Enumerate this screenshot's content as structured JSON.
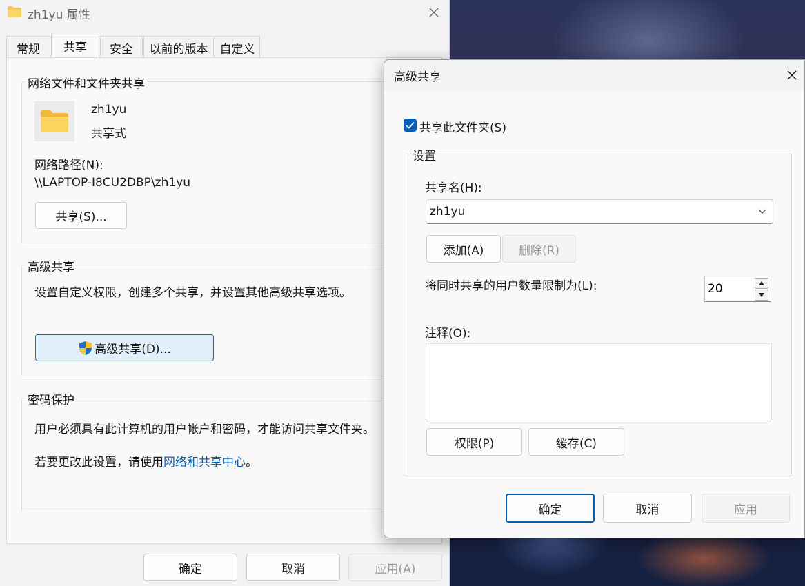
{
  "properties_window": {
    "title": "zh1yu 属性",
    "tabs": [
      {
        "label": "常规"
      },
      {
        "label": "共享"
      },
      {
        "label": "安全"
      },
      {
        "label": "以前的版本"
      },
      {
        "label": "自定义"
      }
    ],
    "network_sharing": {
      "group_title": "网络文件和文件夹共享",
      "folder_name": "zh1yu",
      "folder_status": "共享式",
      "path_label": "网络路径(N):",
      "path_value": "\\\\LAPTOP-I8CU2DBP\\zh1yu",
      "share_button": "共享(S)..."
    },
    "advanced_sharing": {
      "group_title": "高级共享",
      "description": "设置自定义权限，创建多个共享，并设置其他高级共享选项。",
      "button": "高级共享(D)..."
    },
    "password_protection": {
      "group_title": "密码保护",
      "description": "用户必须具有此计算机的用户帐户和密码，才能访问共享文件夹。",
      "change_prefix": "若要更改此设置，请使用",
      "change_link": "网络和共享中心",
      "change_suffix": "。"
    },
    "footer": {
      "ok": "确定",
      "cancel": "取消",
      "apply": "应用(A)"
    }
  },
  "advanced_dialog": {
    "title": "高级共享",
    "share_checkbox_label": "共享此文件夹(S)",
    "share_checked": true,
    "settings": {
      "group_title": "设置",
      "share_name_label": "共享名(H):",
      "share_name_value": "zh1yu",
      "add_button": "添加(A)",
      "remove_button": "删除(R)",
      "user_limit_label": "将同时共享的用户数量限制为(L):",
      "user_limit_value": "20",
      "comment_label": "注释(O):",
      "comment_value": "",
      "permissions_button": "权限(P)",
      "caching_button": "缓存(C)"
    },
    "footer": {
      "ok": "确定",
      "cancel": "取消",
      "apply": "应用"
    }
  },
  "colors": {
    "accent": "#005fb8",
    "link": "#0b5cad",
    "folder": "#f8c94a"
  },
  "icons": {
    "folder": "folder-icon",
    "close": "close-icon",
    "shield": "uac-shield-icon",
    "check": "checkmark-icon",
    "chevron": "chevron-down-icon"
  }
}
